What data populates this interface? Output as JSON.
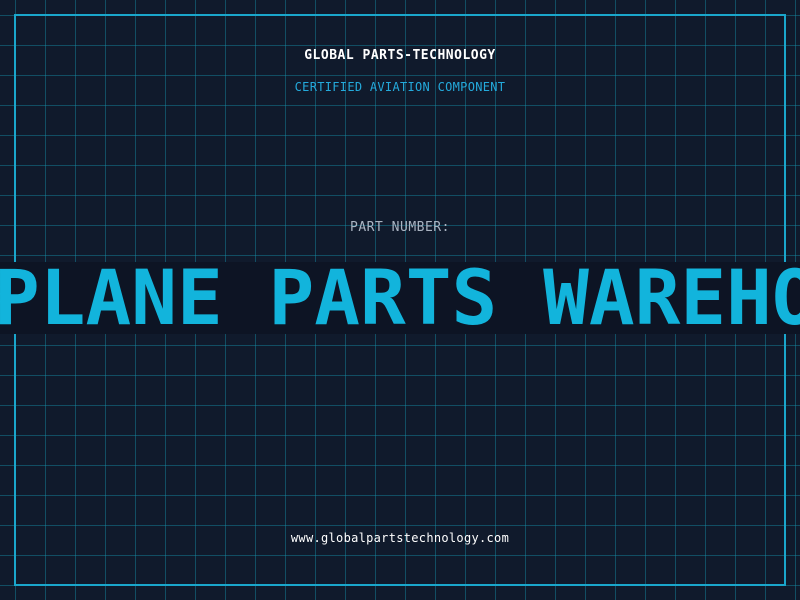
{
  "header": {
    "brand": "GLOBAL PARTS-TECHNOLOGY",
    "subtitle": "CERTIFIED AVIATION COMPONENT"
  },
  "part": {
    "label": "PART NUMBER:",
    "value": "PLANE PARTS WAREHOUSE"
  },
  "footer": {
    "website": "www.globalpartstechnology.com"
  },
  "colors": {
    "background": "#101a2c",
    "grid": "#168fa8",
    "accent": "#1aa6cc",
    "banner_text": "#12b4dc",
    "label_text": "#aab4c2"
  }
}
